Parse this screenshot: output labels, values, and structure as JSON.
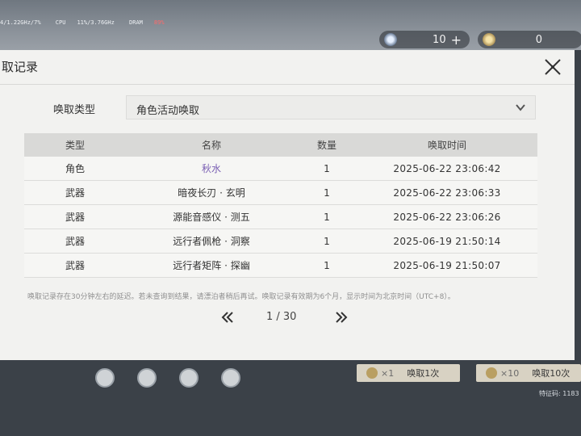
{
  "perf": {
    "cpu_clock": "4/1.22GHz/7%",
    "cpu_label": "CPU",
    "cpu_value": "11%/3.76GHz",
    "dram_label": "DRAM",
    "dram_value": "89%"
  },
  "currencies": [
    {
      "icon": "star-crystal-icon",
      "value": "10",
      "plus": "+"
    },
    {
      "icon": "coin-icon",
      "value": "0"
    }
  ],
  "dialog": {
    "title": "取记录",
    "filter_label": "唤取类型",
    "filter_value": "角色活动唤取",
    "columns": [
      "类型",
      "名称",
      "数量",
      "唤取时间"
    ],
    "rows": [
      {
        "type": "角色",
        "name": "秋水",
        "qty": "1",
        "time": "2025-06-22 23:06:42"
      },
      {
        "type": "武器",
        "name": "暗夜长刃 · 玄明",
        "qty": "1",
        "time": "2025-06-22 23:06:33"
      },
      {
        "type": "武器",
        "name": "源能音感仪 · 测五",
        "qty": "1",
        "time": "2025-06-22 23:06:26"
      },
      {
        "type": "武器",
        "name": "远行者佩枪 · 洞察",
        "qty": "1",
        "time": "2025-06-19 21:50:14"
      },
      {
        "type": "武器",
        "name": "远行者矩阵 · 探幽",
        "qty": "1",
        "time": "2025-06-19 21:50:07"
      }
    ],
    "note": "唤取记录存在30分钟左右的延迟。若未查询到结果，请漂泊者稍后再试。唤取记录有效期为6个月，显示时间为北京时间（UTC+8）。",
    "pager": {
      "text": "1 / 30"
    }
  },
  "bottom": {
    "pull_one": {
      "count": "×1",
      "label": "唤取1次"
    },
    "pull_ten": {
      "count": "×10",
      "label": "唤取10次"
    },
    "footer_id": "特征码: 1183"
  },
  "colors": {
    "accent_name": "#7a5fb3"
  }
}
